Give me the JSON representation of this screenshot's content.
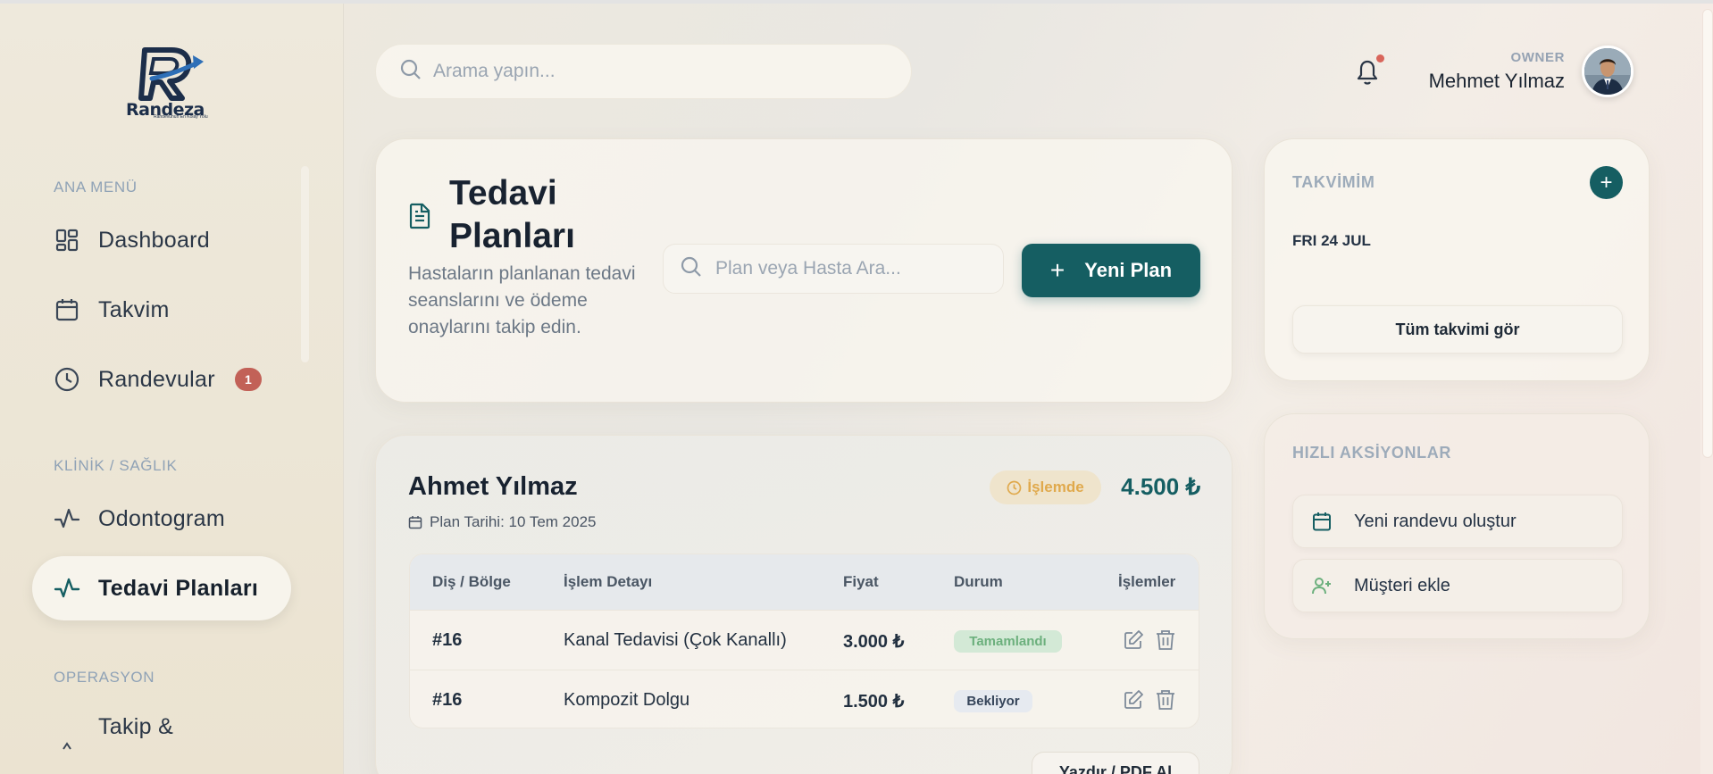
{
  "brand": {
    "name": "Randeza",
    "tagline": "Randevunun En Kolay Yolu"
  },
  "search": {
    "placeholder": "Arama yapın..."
  },
  "user": {
    "role": "OWNER",
    "name": "Mehmet Yılmaz"
  },
  "sidebar": {
    "sections": [
      {
        "label": "ANA MENÜ"
      },
      {
        "label": "KLİNİK / SAĞLIK"
      },
      {
        "label": "OPERASYON"
      }
    ],
    "items": [
      {
        "label": "Dashboard",
        "icon": "dashboard-icon"
      },
      {
        "label": "Takvim",
        "icon": "calendar-icon"
      },
      {
        "label": "Randevular",
        "icon": "clock-icon",
        "badge": "1"
      },
      {
        "label": "Odontogram",
        "icon": "activity-icon"
      },
      {
        "label": "Tedavi Planları",
        "icon": "activity-icon",
        "active": true
      },
      {
        "label": "Takip &",
        "icon": "chevron-up-icon"
      }
    ]
  },
  "page": {
    "title": "Tedavi Planları",
    "description": "Hastaların planlanan tedavi seanslarını ve ödeme onaylarını takip edin.",
    "search_placeholder": "Plan veya Hasta Ara...",
    "new_button": "Yeni Plan"
  },
  "plan": {
    "patient": "Ahmet Yılmaz",
    "date": "Plan Tarihi: 10 Tem 2025",
    "status": "İşlemde",
    "total": "4.500 ₺",
    "columns": [
      "Diş / Bölge",
      "İşlem Detayı",
      "Fiyat",
      "Durum",
      "İşlemler"
    ],
    "rows": [
      {
        "tooth": "#16",
        "detail": "Kanal Tedavisi (Çok Kanallı)",
        "price": "3.000 ₺",
        "status": "Tamamlandı"
      },
      {
        "tooth": "#16",
        "detail": "Kompozit Dolgu",
        "price": "1.500 ₺",
        "status": "Bekliyor"
      }
    ],
    "print_button": "Yazdır / PDF Al"
  },
  "calendar": {
    "title": "TAKVİMİM",
    "date": "FRI 24 JUL",
    "view_all": "Tüm takvimi gör"
  },
  "quick_actions": {
    "title": "HIZLI AKSİYONLAR",
    "items": [
      {
        "label": "Yeni randevu oluştur",
        "icon": "calendar-icon"
      },
      {
        "label": "Müşteri ekle",
        "icon": "user-plus-icon"
      }
    ]
  },
  "colors": {
    "accent": "#155e62",
    "badge": "#c26157",
    "pending": "#e0a94c",
    "done": "#6cb07d"
  }
}
